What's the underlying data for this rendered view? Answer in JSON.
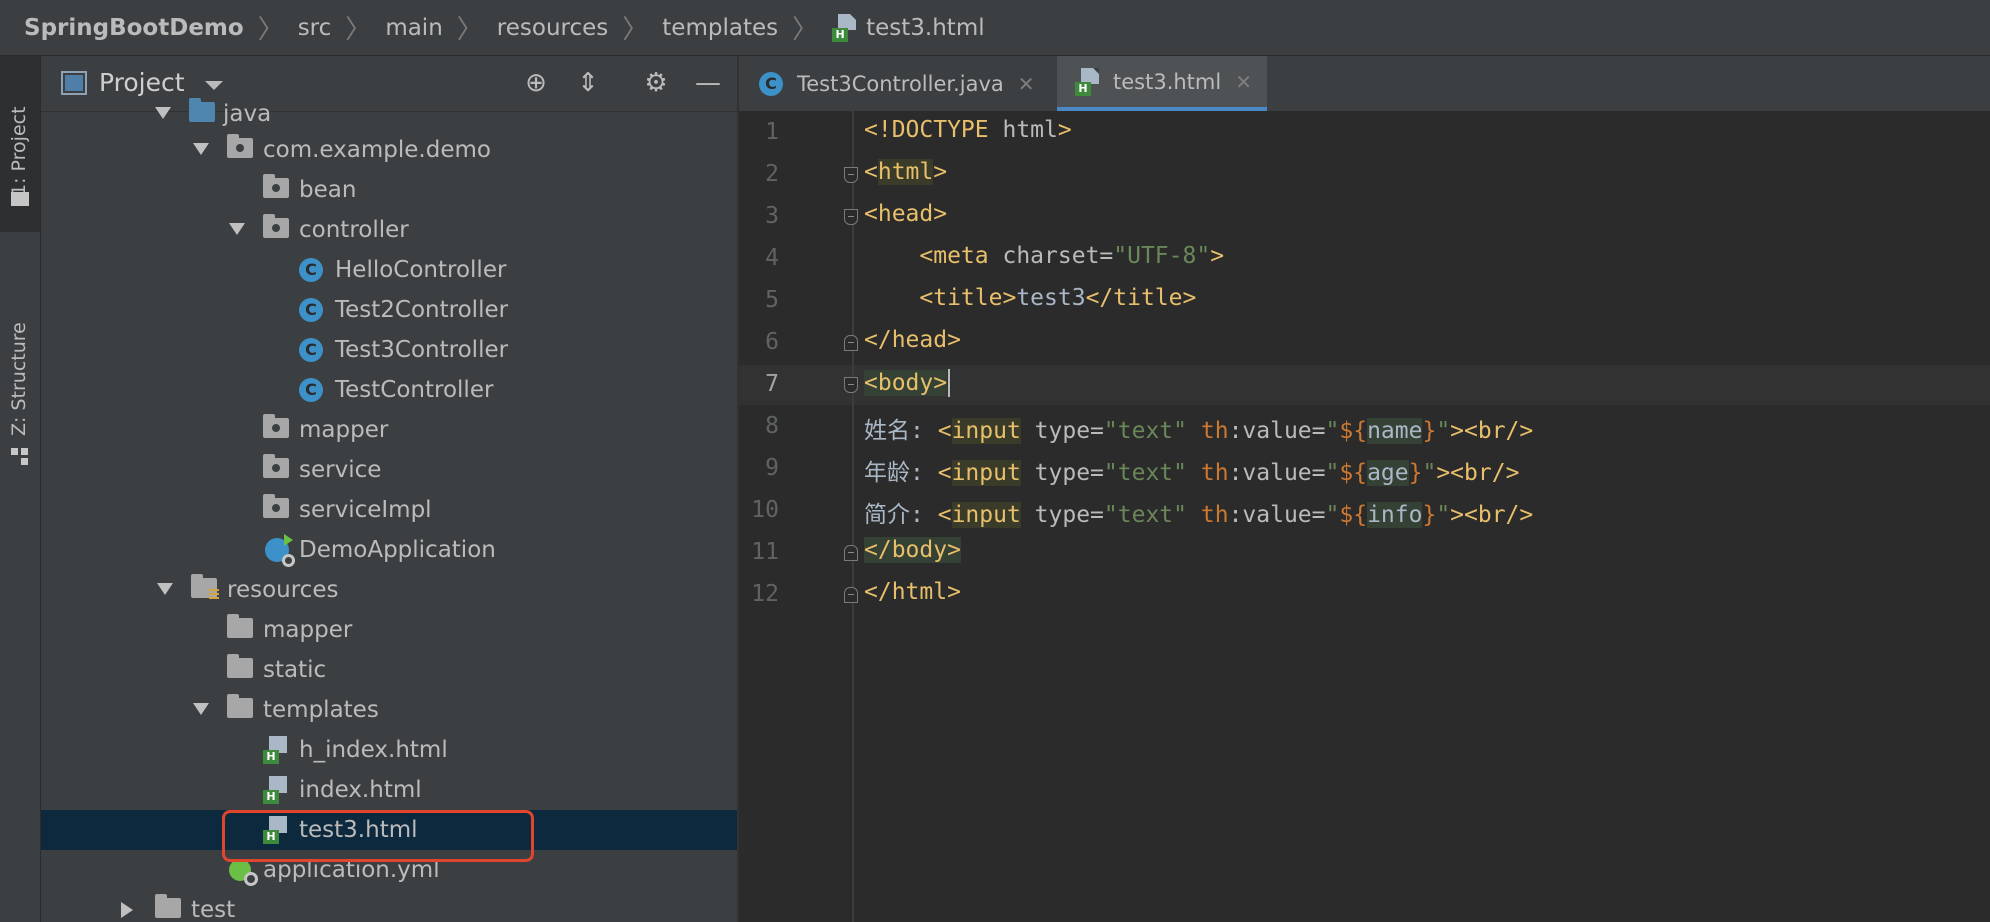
{
  "breadcrumb": {
    "items": [
      "SpringBootDemo",
      "src",
      "main",
      "resources",
      "templates",
      "test3.html"
    ]
  },
  "left_strip": {
    "project_tab": "1: Project",
    "structure_tab": "Z: Structure"
  },
  "project_panel": {
    "title": "Project",
    "tree": [
      {
        "label": "java",
        "type": "java-folder",
        "expanded": true
      },
      {
        "label": "com.example.demo",
        "type": "package",
        "expanded": true
      },
      {
        "label": "bean",
        "type": "package"
      },
      {
        "label": "controller",
        "type": "package",
        "expanded": true
      },
      {
        "label": "HelloController",
        "type": "class"
      },
      {
        "label": "Test2Controller",
        "type": "class"
      },
      {
        "label": "Test3Controller",
        "type": "class"
      },
      {
        "label": "TestController",
        "type": "class"
      },
      {
        "label": "mapper",
        "type": "package"
      },
      {
        "label": "service",
        "type": "package"
      },
      {
        "label": "serviceImpl",
        "type": "package"
      },
      {
        "label": "DemoApplication",
        "type": "spring-class"
      },
      {
        "label": "resources",
        "type": "resources-folder",
        "expanded": true
      },
      {
        "label": "mapper",
        "type": "folder"
      },
      {
        "label": "static",
        "type": "folder"
      },
      {
        "label": "templates",
        "type": "folder",
        "expanded": true
      },
      {
        "label": "h_index.html",
        "type": "html"
      },
      {
        "label": "index.html",
        "type": "html"
      },
      {
        "label": "test3.html",
        "type": "html",
        "selected": true
      },
      {
        "label": "application.yml",
        "type": "yml"
      },
      {
        "label": "test",
        "type": "folder",
        "expanded": false
      }
    ]
  },
  "editor_tabs": [
    {
      "label": "Test3Controller.java",
      "icon": "class-icon",
      "active": false
    },
    {
      "label": "test3.html",
      "icon": "html-file-icon",
      "active": true
    }
  ],
  "editor": {
    "current_line": 7,
    "line_numbers": [
      "1",
      "2",
      "3",
      "4",
      "5",
      "6",
      "7",
      "8",
      "9",
      "10",
      "11",
      "12"
    ],
    "lines": [
      "<!DOCTYPE html>",
      "<html>",
      "<head>",
      "    <meta charset=\"UTF-8\">",
      "    <title>test3</title>",
      "</head>",
      "<body>",
      "姓名: <input type=\"text\" th:value=\"${name}\"><br/>",
      "年龄: <input type=\"text\" th:value=\"${age}\"><br/>",
      "简介: <input type=\"text\" th:value=\"${info}\"><br/>",
      "</body>",
      "</html>"
    ]
  },
  "colors": {
    "tag": "#e8bf6a",
    "string": "#6a8759",
    "keyword": "#cc7832",
    "selection": "#0d293e",
    "highlight_box": "#e0452e"
  }
}
